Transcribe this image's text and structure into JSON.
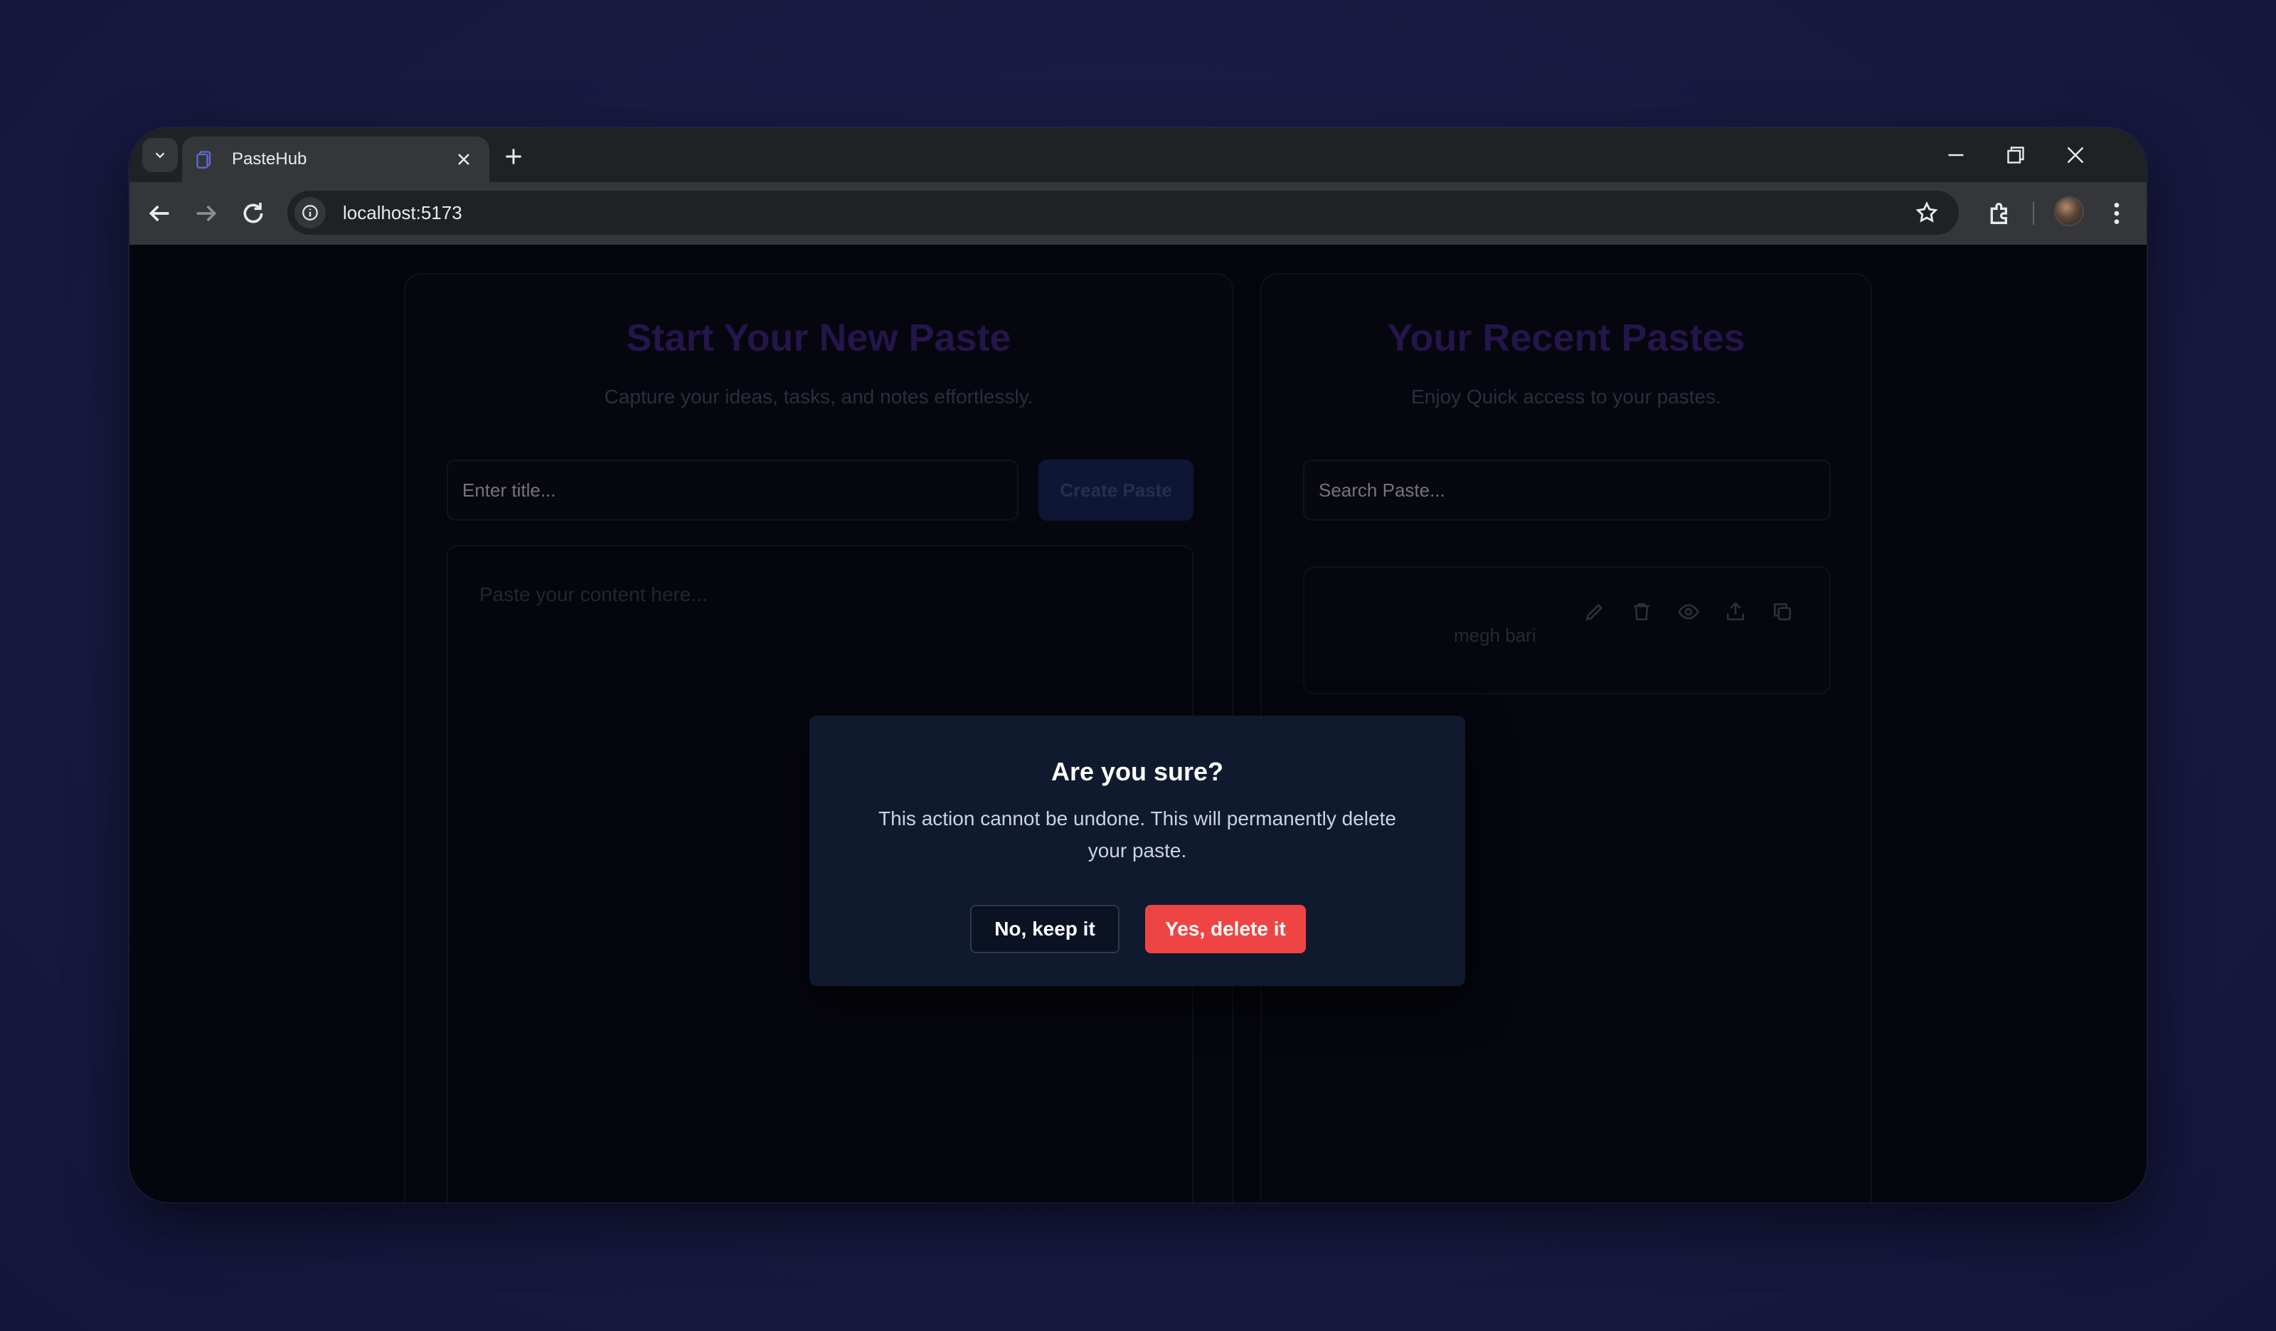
{
  "browser": {
    "tab_title": "PasteHub",
    "url": "localhost:5173",
    "icons": {
      "tab_search": "chevron-down-icon",
      "tab_close": "close-icon",
      "new_tab": "plus-icon",
      "back": "arrow-left-icon",
      "forward": "arrow-right-icon",
      "reload": "reload-icon",
      "site_info": "info-icon",
      "bookmark": "star-icon",
      "extensions": "puzzle-icon",
      "menu": "kebab-menu-icon",
      "minimize": "minimize-icon",
      "restore": "restore-icon",
      "close_window": "close-icon"
    }
  },
  "left_panel": {
    "title": "Start Your New Paste",
    "subtitle": "Capture your ideas, tasks, and notes effortlessly.",
    "title_placeholder": "Enter title...",
    "create_button": "Create Paste",
    "content_placeholder": "Paste your content here..."
  },
  "right_panel": {
    "title": "Your Recent Pastes",
    "subtitle": "Enjoy Quick access to your pastes.",
    "search_placeholder": "Search Paste...",
    "paste_card": {
      "snippet": "megh bari",
      "action_icons": [
        "edit-icon",
        "trash-icon",
        "eye-icon",
        "share-icon",
        "copy-icon"
      ]
    }
  },
  "dialog": {
    "title": "Are you sure?",
    "message": "This action cannot be undone. This will permanently delete your paste.",
    "cancel_label": "No, keep it",
    "confirm_label": "Yes, delete it"
  },
  "colors": {
    "backdrop": "#181a40",
    "dialog_bg": "#0f1a2e",
    "danger": "#ef4444",
    "title_purple": "#24154a"
  }
}
